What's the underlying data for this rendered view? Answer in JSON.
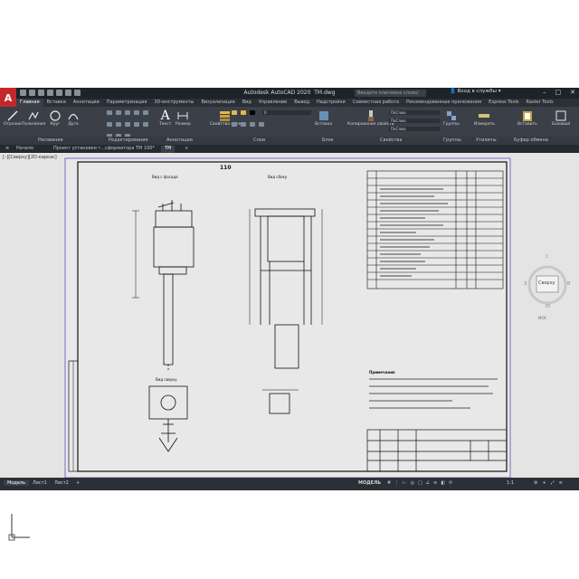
{
  "title": {
    "app": "Autodesk AutoCAD 2020",
    "file": "TM.dwg",
    "search_placeholder": "Введите ключевое слово/фразу",
    "login": "Вход в службы",
    "logo": "A"
  },
  "ribbon_tabs": [
    "Главная",
    "Вставка",
    "Аннотации",
    "Параметризация",
    "3D-инструменты",
    "Визуализация",
    "Вид",
    "Управление",
    "Вывод",
    "Надстройки",
    "Совместная работа",
    "Рекомендованные приложения",
    "Express Tools",
    "Raster Tools"
  ],
  "ribbon_tools": {
    "otrezok": "Отрезок",
    "polyline": "Полилиния",
    "circle": "Круг",
    "arc": "Дуга",
    "text": "Текст",
    "dimension": "Размер",
    "layer_props": "Свойства слоя",
    "insert": "Вставка",
    "match_props": "Копирование свойств",
    "groups": "Группы",
    "measure": "Измерить",
    "paste": "Вставить",
    "base": "Базовый",
    "layer_name": "ПоСлою"
  },
  "panels": [
    "Рисование",
    "Редактирование",
    "Аннотации",
    "Слои",
    "Блок",
    "Свойства",
    "Группы",
    "Утилиты",
    "Буфер обмена"
  ],
  "doc_tabs": {
    "start": "Начало",
    "project": "Проект установки т...сформатора ТМ 100*",
    "tm": "TM"
  },
  "viewport_label": "[–][Сверху][2D-каркас]",
  "navcube": {
    "face": "Сверху",
    "north": "С",
    "south": "Ю",
    "east": "В",
    "west": "З",
    "wcs": "МСК"
  },
  "drawing": {
    "title": "110",
    "view_front": "Вид с фасада",
    "view_side": "Вид сбоку",
    "view_top": "Вид сверху",
    "notes_header": "Примечания"
  },
  "status": {
    "model": "Модель",
    "layout1": "Лист1",
    "layout2": "Лист2",
    "add": "+",
    "model_btn": "МОДЕЛЬ",
    "scale": "1:1"
  },
  "colors": {
    "accent": "#c3282e",
    "ribbon": "#3b4048",
    "canvas": "#e4e4e4"
  }
}
